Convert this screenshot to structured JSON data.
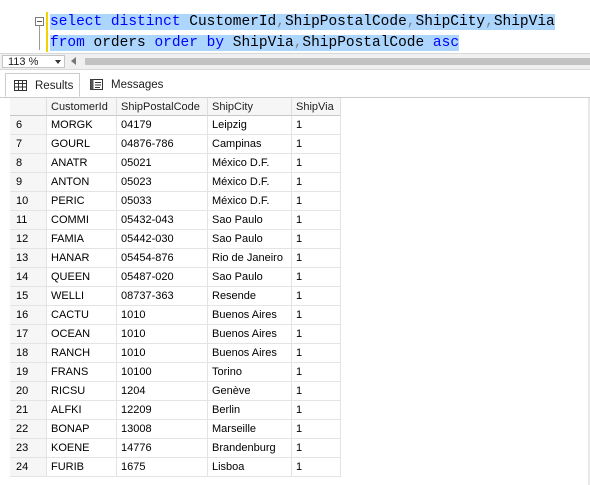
{
  "editor": {
    "line1": [
      {
        "t": "select",
        "c": "kw"
      },
      {
        "t": " ",
        "c": "tx"
      },
      {
        "t": "distinct",
        "c": "kw"
      },
      {
        "t": " CustomerId",
        "c": "tx"
      },
      {
        "t": ",",
        "c": "gr"
      },
      {
        "t": "ShipPostalCode",
        "c": "tx"
      },
      {
        "t": ",",
        "c": "gr"
      },
      {
        "t": "ShipCity",
        "c": "tx"
      },
      {
        "t": ",",
        "c": "gr"
      },
      {
        "t": "ShipVia",
        "c": "tx"
      }
    ],
    "line2": [
      {
        "t": "from",
        "c": "kw"
      },
      {
        "t": " orders ",
        "c": "tx"
      },
      {
        "t": "order",
        "c": "kw"
      },
      {
        "t": " ",
        "c": "tx"
      },
      {
        "t": "by",
        "c": "kw"
      },
      {
        "t": " ShipVia",
        "c": "tx"
      },
      {
        "t": ",",
        "c": "gr"
      },
      {
        "t": "ShipPostalCode ",
        "c": "tx"
      },
      {
        "t": "asc",
        "c": "kw"
      }
    ]
  },
  "zoom": {
    "value": "113 %"
  },
  "tabs": {
    "results": "Results",
    "messages": "Messages"
  },
  "grid": {
    "columns": [
      "CustomerId",
      "ShipPostalCode",
      "ShipCity",
      "ShipVia"
    ],
    "rows": [
      {
        "n": "6",
        "cells": [
          "MORGK",
          "04179",
          "Leipzig",
          "1"
        ]
      },
      {
        "n": "7",
        "cells": [
          "GOURL",
          "04876-786",
          "Campinas",
          "1"
        ]
      },
      {
        "n": "8",
        "cells": [
          "ANATR",
          "05021",
          "México D.F.",
          "1"
        ]
      },
      {
        "n": "9",
        "cells": [
          "ANTON",
          "05023",
          "México D.F.",
          "1"
        ]
      },
      {
        "n": "10",
        "cells": [
          "PERIC",
          "05033",
          "México D.F.",
          "1"
        ]
      },
      {
        "n": "11",
        "cells": [
          "COMMI",
          "05432-043",
          "Sao Paulo",
          "1"
        ]
      },
      {
        "n": "12",
        "cells": [
          "FAMIA",
          "05442-030",
          "Sao Paulo",
          "1"
        ]
      },
      {
        "n": "13",
        "cells": [
          "HANAR",
          "05454-876",
          "Rio de Janeiro",
          "1"
        ]
      },
      {
        "n": "14",
        "cells": [
          "QUEEN",
          "05487-020",
          "Sao Paulo",
          "1"
        ]
      },
      {
        "n": "15",
        "cells": [
          "WELLI",
          "08737-363",
          "Resende",
          "1"
        ]
      },
      {
        "n": "16",
        "cells": [
          "CACTU",
          "1010",
          "Buenos Aires",
          "1"
        ]
      },
      {
        "n": "17",
        "cells": [
          "OCEAN",
          "1010",
          "Buenos Aires",
          "1"
        ]
      },
      {
        "n": "18",
        "cells": [
          "RANCH",
          "1010",
          "Buenos Aires",
          "1"
        ]
      },
      {
        "n": "19",
        "cells": [
          "FRANS",
          "10100",
          "Torino",
          "1"
        ]
      },
      {
        "n": "20",
        "cells": [
          "RICSU",
          "1204",
          "Genève",
          "1"
        ]
      },
      {
        "n": "21",
        "cells": [
          "ALFKI",
          "12209",
          "Berlin",
          "1"
        ]
      },
      {
        "n": "22",
        "cells": [
          "BONAP",
          "13008",
          "Marseille",
          "1"
        ]
      },
      {
        "n": "23",
        "cells": [
          "KOENE",
          "14776",
          "Brandenburg",
          "1"
        ]
      },
      {
        "n": "24",
        "cells": [
          "FURIB",
          "1675",
          "Lisboa",
          "1"
        ]
      }
    ]
  }
}
